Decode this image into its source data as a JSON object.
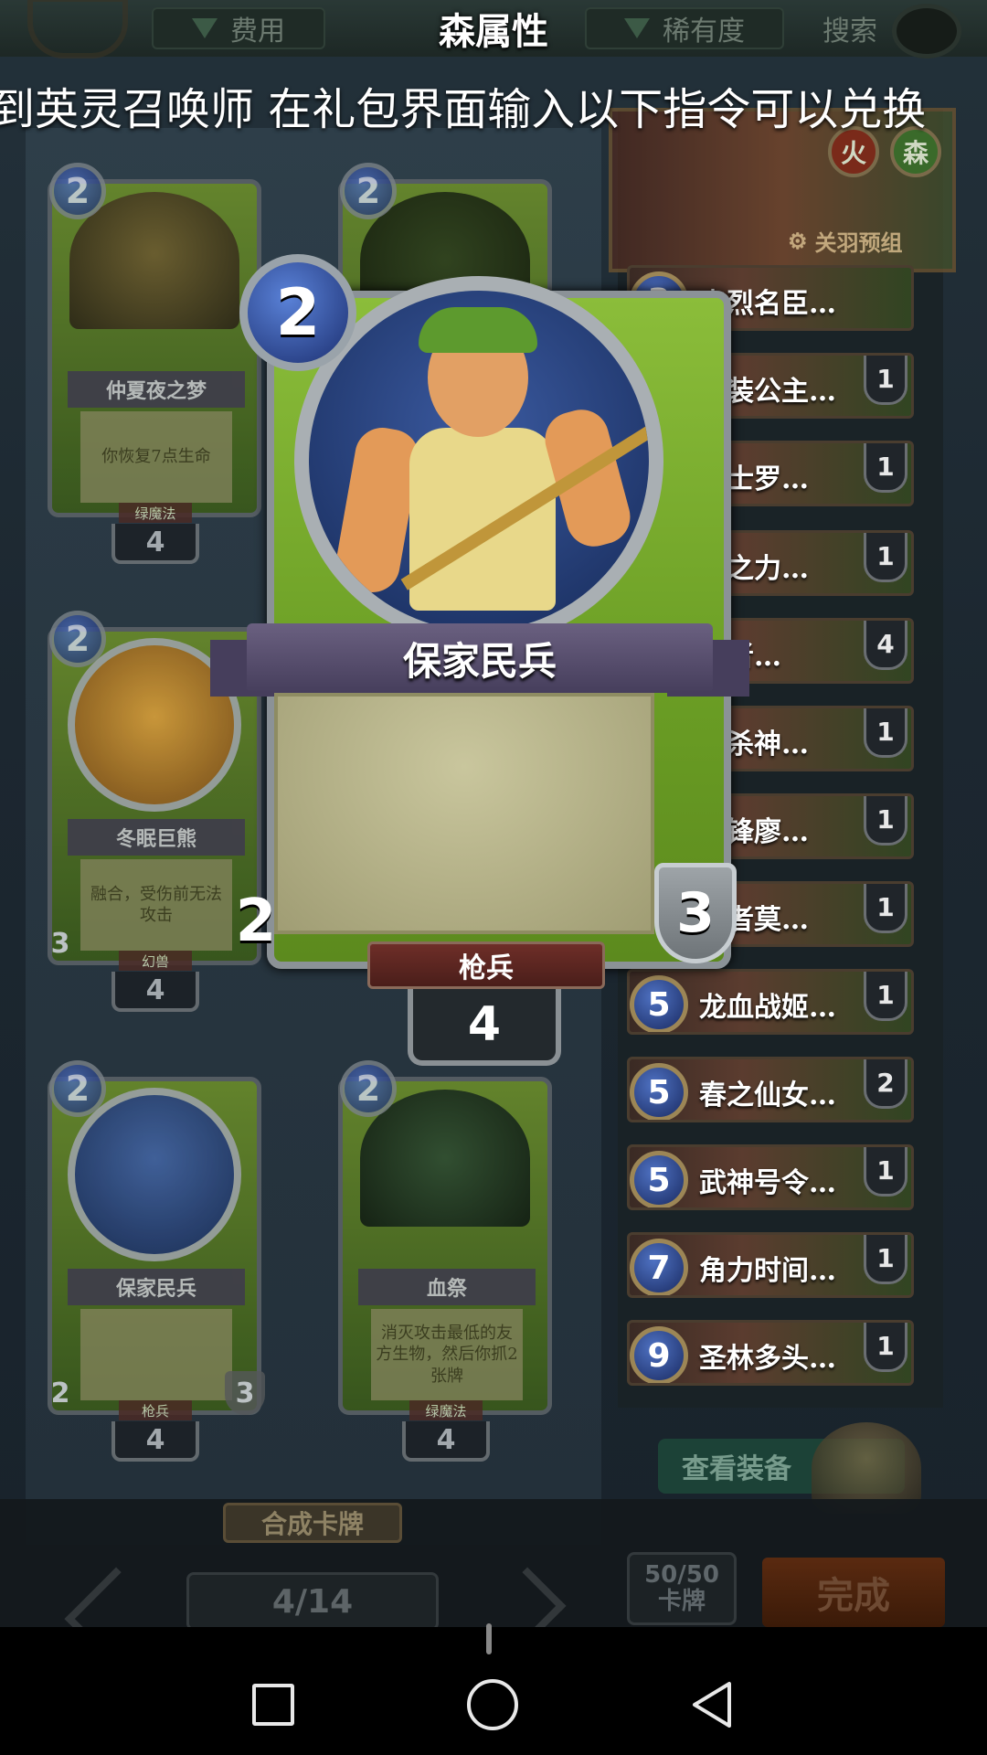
{
  "header": {
    "title": "森属性",
    "filter_cost": "费用",
    "filter_rarity": "稀有度",
    "search_label": "搜索"
  },
  "marquee": "到英灵召唤师 在礼包界面输入以下指令可以兑换",
  "collection": {
    "cards": [
      {
        "cost": "2",
        "name": "仲夏夜之梦",
        "text": "你恢复7点生命",
        "race": "绿魔法",
        "count": "4"
      },
      {
        "cost": "2",
        "name": "",
        "text": "",
        "race": "",
        "count": ""
      },
      {
        "cost": "2",
        "name": "冬眠巨熊",
        "text": "融合，受伤前无法攻击",
        "race": "幻兽",
        "attack": "3",
        "count": "4"
      },
      {
        "cost": "2",
        "name": "保家民兵",
        "text": "",
        "race": "枪兵",
        "attack": "2",
        "health": "3",
        "count": "4"
      },
      {
        "cost": "2",
        "name": "血祭",
        "text": "消灭攻击最低的友方生物，然后你抓2张牌",
        "race": "绿魔法",
        "count": "4"
      }
    ],
    "craft_label": "合成卡牌",
    "page": "4/14"
  },
  "detail_card": {
    "cost": "2",
    "name": "保家民兵",
    "attack": "2",
    "health": "3",
    "race": "枪兵",
    "count": "4",
    "frame_color": "#7fb232"
  },
  "deck": {
    "hero": {
      "elements": [
        "火",
        "森"
      ],
      "preset_label": "关羽预组"
    },
    "rows": [
      {
        "cost": "3",
        "name": "忠烈名臣…",
        "count": ""
      },
      {
        "cost": "",
        "name": "武装公主…",
        "count": "1"
      },
      {
        "cost": "",
        "name": "骑士罗…",
        "count": "1"
      },
      {
        "cost": "",
        "name": "兽之力…",
        "count": "1"
      },
      {
        "cost": "",
        "name": "武者…",
        "count": "4"
      },
      {
        "cost": "",
        "name": "骨杀神…",
        "count": "1"
      },
      {
        "cost": "",
        "name": "先锋廖…",
        "count": "1"
      },
      {
        "cost": "",
        "name": "乱者莫…",
        "count": "1"
      },
      {
        "cost": "5",
        "name": "龙血战姬…",
        "count": "1"
      },
      {
        "cost": "5",
        "name": "春之仙女…",
        "count": "2"
      },
      {
        "cost": "5",
        "name": "武神号令…",
        "count": "1"
      },
      {
        "cost": "7",
        "name": "角力时间…",
        "count": "1"
      },
      {
        "cost": "9",
        "name": "圣林多头…",
        "count": "1"
      }
    ],
    "equip_label": "查看装备",
    "deck_size": "50/50",
    "deck_size_unit": "卡牌",
    "done_label": "完成"
  }
}
